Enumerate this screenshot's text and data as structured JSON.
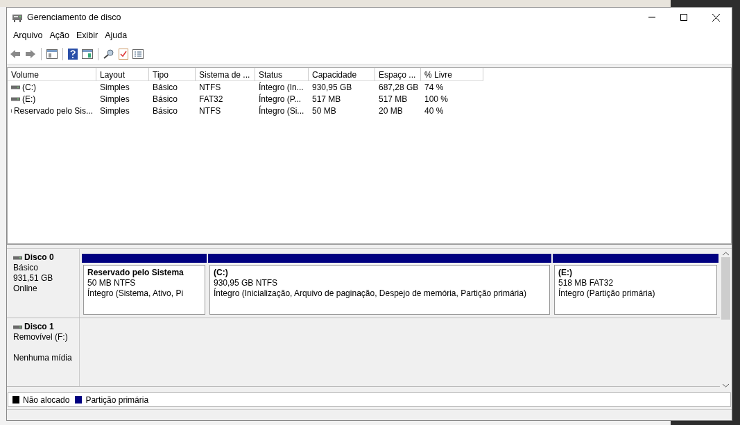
{
  "window": {
    "title": "Gerenciamento de disco"
  },
  "menu": [
    "Arquivo",
    "Ação",
    "Exibir",
    "Ajuda"
  ],
  "table": {
    "columns": [
      "Volume",
      "Layout",
      "Tipo",
      "Sistema de ...",
      "Status",
      "Capacidade",
      "Espaço ...",
      "% Livre"
    ],
    "rows": [
      [
        "(C:)",
        "Simples",
        "Básico",
        "NTFS",
        "Íntegro (In...",
        "930,95 GB",
        "687,28 GB",
        "74 %"
      ],
      [
        "(E:)",
        "Simples",
        "Básico",
        "FAT32",
        "Íntegro (P...",
        "517 MB",
        "517 MB",
        "100 %"
      ],
      [
        "Reservado pelo Sis...",
        "Simples",
        "Básico",
        "NTFS",
        "Íntegro (Si...",
        "50 MB",
        "20 MB",
        "40 %"
      ]
    ]
  },
  "disks": [
    {
      "name": "Disco 0",
      "type": "Básico",
      "size": "931,51 GB",
      "status": "Online",
      "partitions": [
        {
          "name": "Reservado pelo Sistema",
          "size": "50 MB NTFS",
          "status": "Íntegro (Sistema, Ativo, Pi",
          "color": "#000080"
        },
        {
          "name": "(C:)",
          "size": "930,95 GB NTFS",
          "status": "Íntegro (Inicialização, Arquivo de paginação, Despejo de memória, Partição primária)",
          "color": "#000080"
        },
        {
          "name": "(E:)",
          "size": "518 MB FAT32",
          "status": "Íntegro (Partição primária)",
          "color": "#000080"
        }
      ]
    },
    {
      "name": "Disco 1",
      "type": "Removível (F:)",
      "status": "Nenhuma mídia"
    }
  ],
  "legend": [
    {
      "label": "Não alocado",
      "color": "#000000"
    },
    {
      "label": "Partição primária",
      "color": "#000080"
    }
  ]
}
